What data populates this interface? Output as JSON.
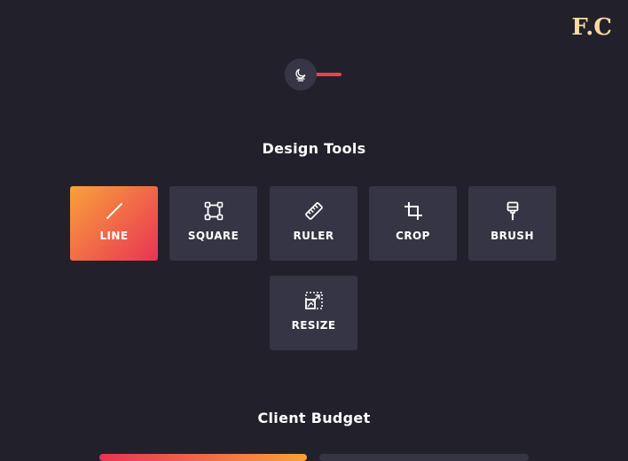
{
  "logo": {
    "text": "F.C"
  },
  "theme_toggle": {
    "icon": "moon-cloud-icon",
    "accent": "#e8434f"
  },
  "design_tools": {
    "title": "Design Tools",
    "active_color_start": "#f9a13a",
    "active_color_end": "#e83455",
    "tiles": [
      {
        "label": "LINE",
        "icon": "line-icon",
        "active": true
      },
      {
        "label": "SQUARE",
        "icon": "square-icon",
        "active": false
      },
      {
        "label": "RULER",
        "icon": "ruler-icon",
        "active": false
      },
      {
        "label": "CROP",
        "icon": "crop-icon",
        "active": false
      },
      {
        "label": "BRUSH",
        "icon": "brush-icon",
        "active": false
      },
      {
        "label": "RESIZE",
        "icon": "resize-icon",
        "active": false
      }
    ]
  },
  "client_budget": {
    "title": "Client Budget"
  }
}
